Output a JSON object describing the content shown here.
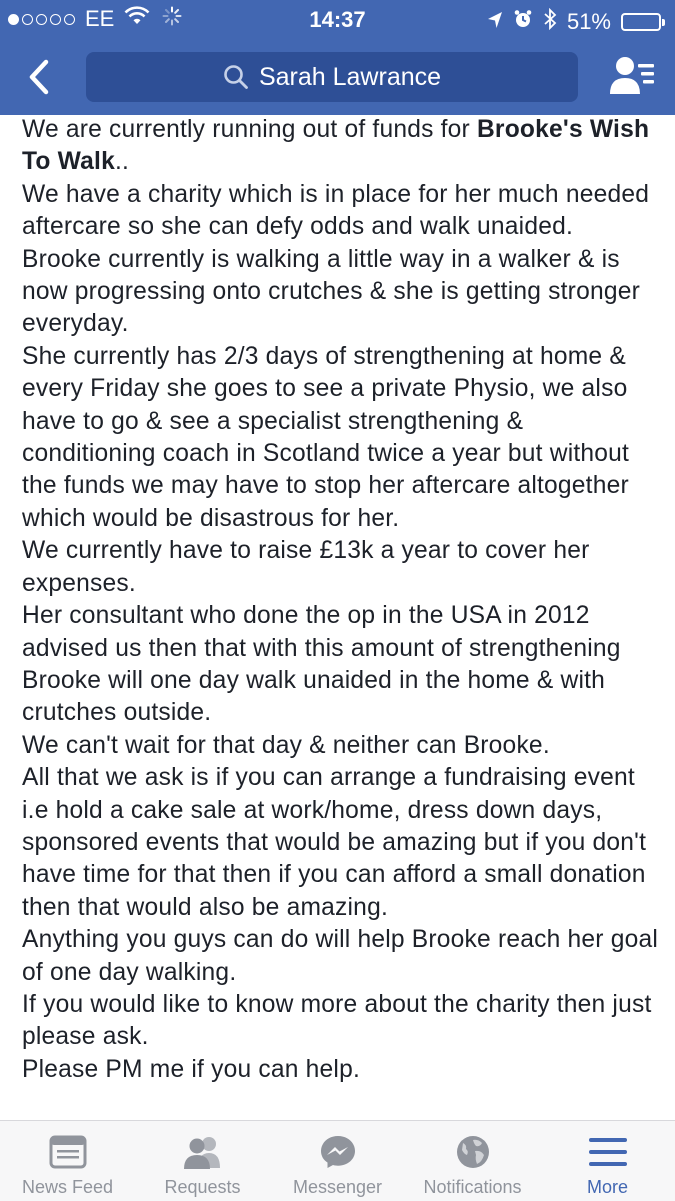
{
  "status_bar": {
    "carrier": "EE",
    "time": "14:37",
    "battery_percent": "51%",
    "battery_level": 0.51,
    "signal_bars": 1
  },
  "nav": {
    "search_text": "Sarah Lawrance",
    "accent_color": "#4267b2"
  },
  "post": {
    "p1_a": "We are currently running out of funds for ",
    "p1_bold": "Brooke's Wish To Walk",
    "p1_b": "..",
    "p2": "We have a charity which is in place for her much needed aftercare so she can defy odds and walk unaided.",
    "p3": "Brooke currently is walking a little way in a walker & is now progressing onto crutches & she is getting stronger everyday.",
    "p4": "She currently has 2/3 days of strengthening at home & every Friday she goes to see a private Physio, we also have to go & see a specialist strengthening & conditioning coach in Scotland twice a year but without the funds we may have to stop her aftercare altogether which would be disastrous for her.",
    "p5": "We currently have to raise £13k a year to cover her expenses.",
    "p6": "Her consultant who done the op in the USA in 2012 advised us then that with this amount of strengthening Brooke will one day walk unaided in the home & with crutches outside.",
    "p7": "We can't wait for that day & neither can Brooke.",
    "p8": "All that we ask is if you can arrange a fundraising event i.e hold a cake sale at work/home, dress down days, sponsored events that would be amazing but if you don't have time for that then if you can afford a small donation then that would also be amazing.",
    "p9": "Anything you guys can do will help Brooke reach her goal of one day walking.",
    "p10": "If you would like to know more about the charity then just please ask.",
    "p11": "Please PM me if you can help."
  },
  "tabs": [
    {
      "label": "News Feed",
      "icon": "news-feed-icon"
    },
    {
      "label": "Requests",
      "icon": "friend-requests-icon"
    },
    {
      "label": "Messenger",
      "icon": "messenger-icon"
    },
    {
      "label": "Notifications",
      "icon": "globe-icon"
    },
    {
      "label": "More",
      "icon": "hamburger-menu-icon"
    }
  ],
  "active_tab": "More"
}
